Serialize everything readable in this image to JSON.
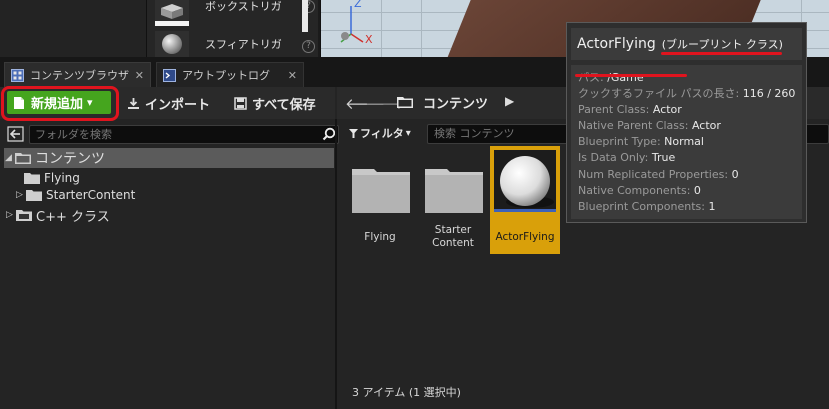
{
  "places": {
    "items": [
      {
        "label": "ボックストリガ"
      },
      {
        "label": "スフィアトリガ"
      }
    ],
    "help_glyph": "?"
  },
  "viewport": {
    "axis_z": "Z",
    "axis_x": "X"
  },
  "tabs": [
    {
      "label": "コンテンツブラウザ",
      "close": "✕"
    },
    {
      "label": "アウトプットログ",
      "close": "✕"
    }
  ],
  "toolbar": {
    "new_label": "新規追加",
    "new_caret": "▾",
    "import_label": "インポート",
    "saveall_label": "すべて保存"
  },
  "breadcrumb": {
    "back": "🡐",
    "forward": "🡒",
    "label": "コンテンツ",
    "chevron": "▶"
  },
  "folders": {
    "search_placeholder": "フォルダを検索",
    "tree": [
      {
        "label": "コンテンツ",
        "arrow": "◢"
      },
      {
        "label": "Flying"
      },
      {
        "label": "StarterContent",
        "arrow": "▷"
      },
      {
        "label": "C++ クラス",
        "arrow": "▷",
        "badge": "C++"
      }
    ]
  },
  "assets": {
    "filter_label": "フィルタ",
    "filter_caret": "▾",
    "search_placeholder": "検索 コンテンツ",
    "items": [
      {
        "label": "Flying"
      },
      {
        "label_line1": "Starter",
        "label_line2": "Content"
      },
      {
        "label": "ActorFlying",
        "selected": true
      }
    ],
    "status": "3 アイテム (1 選択中)"
  },
  "tooltip": {
    "title": "ActorFlying",
    "type": "(ブループリント クラス)",
    "rows": [
      {
        "key": "パス: ",
        "value": "/Game"
      },
      {
        "key": "クックするファイル パスの長さ: ",
        "value": "116 / 260"
      },
      {
        "key": "Parent Class: ",
        "value": "Actor"
      },
      {
        "key": "Native Parent Class: ",
        "value": "Actor"
      },
      {
        "key": "Blueprint Type: ",
        "value": "Normal"
      },
      {
        "key": "Is Data Only: ",
        "value": "True"
      },
      {
        "key": "Num Replicated Properties: ",
        "value": "0"
      },
      {
        "key": "Native Components: ",
        "value": "0"
      },
      {
        "key": "Blueprint Components: ",
        "value": "1"
      }
    ]
  },
  "colors": {
    "accent_green": "#45a51e",
    "selection_orange": "#d9a00a",
    "highlight_red": "#e0141e"
  }
}
